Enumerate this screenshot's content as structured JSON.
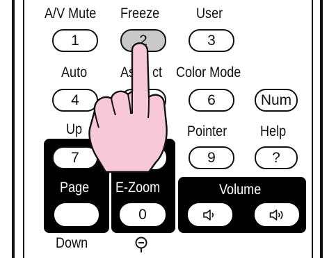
{
  "labels": {
    "av_mute": "A/V Mute",
    "freeze": "Freeze",
    "user": "User",
    "auto": "Auto",
    "aspect_partial": "As",
    "aspect_tail": "ct",
    "color_mode": "Color Mode",
    "page_up_partial": "Up",
    "pointer": "Pointer",
    "help": "Help",
    "page": "Page",
    "e_zoom": "E-Zoom",
    "volume": "Volume",
    "down": "Down"
  },
  "keys": {
    "k1": "1",
    "k2": "2",
    "k3": "3",
    "k4": "4",
    "k6": "6",
    "num": "Num",
    "k7": "7",
    "k9": "9",
    "help": "?",
    "k0": "0"
  },
  "icons": {
    "e_zoom_minus": "zoom-out-icon",
    "vol_down": "volume-down-icon",
    "vol_up": "volume-up-icon",
    "hand": "pointing-hand-icon"
  },
  "colors": {
    "hand_fill": "#f7c9d8",
    "pressed_key": "#c9c9c9",
    "panel": "#000000"
  }
}
